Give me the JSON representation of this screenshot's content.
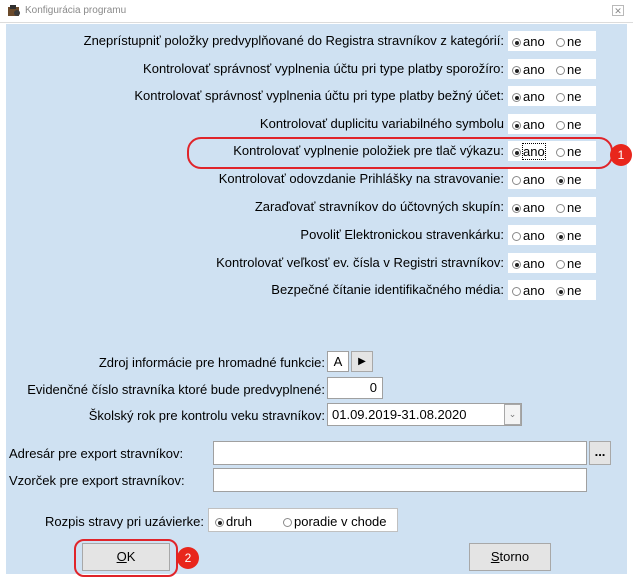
{
  "window": {
    "title": "Konfigurácia programu"
  },
  "options": [
    {
      "label": "Zneprístupniť položky predvyplňované do Registra stravníkov z kategórií:",
      "selected": "ano"
    },
    {
      "label": "Kontrolovať správnosť vyplnenia účtu pri type platby sporožíro:",
      "selected": "ano"
    },
    {
      "label": "Kontrolovať správnosť vyplnenia účtu pri type platby bežný účet:",
      "selected": "ano"
    },
    {
      "label": "Kontrolovať duplicitu variabilného symbolu",
      "selected": "ano"
    },
    {
      "label": "Kontrolovať vyplnenie položiek pre tlač výkazu:",
      "selected": "ano"
    },
    {
      "label": "Kontrolovať odovzdanie Prihlášky na stravovanie:",
      "selected": "ne"
    },
    {
      "label": "Zaraďovať stravníkov do účtovných skupín:",
      "selected": "ano"
    },
    {
      "label": "Povoliť Elektronickou stravenkárku:",
      "selected": "ne"
    },
    {
      "label": "Kontrolovať veľkosť ev. čísla v Registri stravníkov:",
      "selected": "ano"
    },
    {
      "label": "Bezpečné čítanie identifikačného média:",
      "selected": "ne"
    }
  ],
  "radio_labels": {
    "ano": "ano",
    "ne": "ne"
  },
  "fields": {
    "zdroj_label": "Zdroj informácie pre hromadné funkcie:",
    "zdroj_value": "A",
    "evidencne_label": "Evidenčné číslo stravníka ktoré bude predvyplnené:",
    "evidencne_value": "0",
    "skolsky_label": "Školský rok pre kontrolu veku stravníkov:",
    "skolsky_value": "01.09.2019-31.08.2020",
    "adresar_label": "Adresár pre export stravníkov:",
    "adresar_value": "",
    "browse_label": "...",
    "vzorcek_label": "Vzorček pre export stravníkov:",
    "vzorcek_value": ""
  },
  "rozpis": {
    "label": "Rozpis stravy pri uzávierke:",
    "druh": "druh",
    "poradie": "poradie v chode",
    "selected": "druh"
  },
  "buttons": {
    "ok_hotkey": "O",
    "ok_rest": "K",
    "storno_hotkey": "S",
    "storno_rest": "torno"
  },
  "annotations": {
    "badge1": "1",
    "badge2": "2"
  },
  "colors": {
    "panel": "#cfe1f2",
    "highlight": "#e0242a",
    "badge": "#e8261c"
  }
}
